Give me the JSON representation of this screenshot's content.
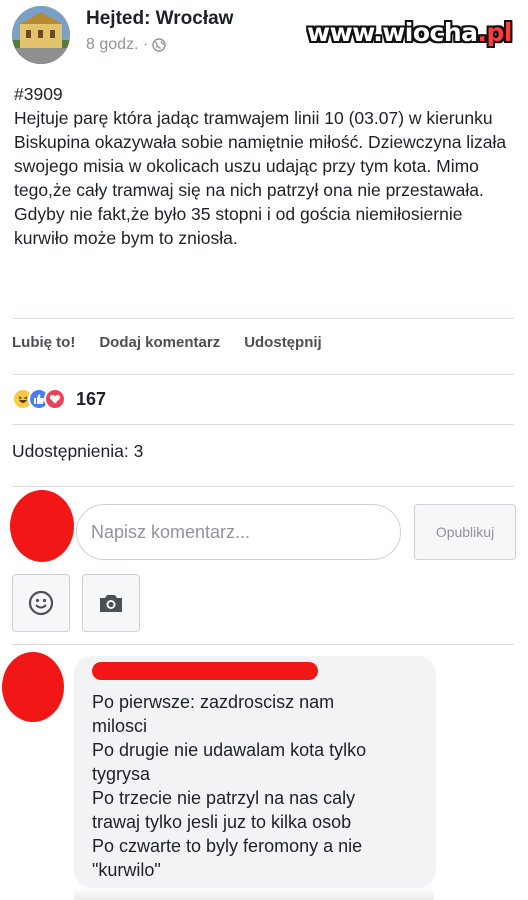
{
  "post": {
    "page_name": "Hejted: Wrocław",
    "time": "8 godz. ·",
    "privacy_icon": "globe-icon",
    "text": "#3909\nHejtuje parę która jadąc tramwajem linii 10 (03.07) w kierunku Biskupina okazywała sobie namiętnie miłość. Dziewczyna lizała swojego misia w okolicach uszu udając przy tym kota. Mimo tego,że cały tramwaj się na nich patrzył ona nie przestawała. Gdyby nie fakt,że było 35 stopni i od gościa niemiłosiernie kurwiło może bym to zniosła."
  },
  "watermark": {
    "main": "www.wiocha",
    "accent": ".pl"
  },
  "actions": {
    "like": "Lubię to!",
    "comment": "Dodaj komentarz",
    "share": "Udostępnij"
  },
  "reactions": {
    "icons": [
      "haha-icon",
      "like-icon",
      "love-icon"
    ],
    "count": "167"
  },
  "shares": {
    "label": "Udostępnienia: 3"
  },
  "comment_box": {
    "placeholder": "Napisz komentarz...",
    "publish_label": "Opublikuj"
  },
  "attachments": {
    "emoji_icon": "smiley-icon",
    "camera_icon": "camera-icon"
  },
  "reply": {
    "text": "Po pierwsze: zazdroscisz nam\nmilosci\nPo drugie nie udawalam kota tylko\ntygrysa\nPo trzecie nie patrzyl na nas caly\ntrawaj tylko jesli juz to kilka osob\nPo czwarte to byly feromony a nie\n\"kurwilo\""
  },
  "colors": {
    "redaction": "#f11717",
    "link_blue": "#4a7df5",
    "meta_gray": "#90949c"
  }
}
